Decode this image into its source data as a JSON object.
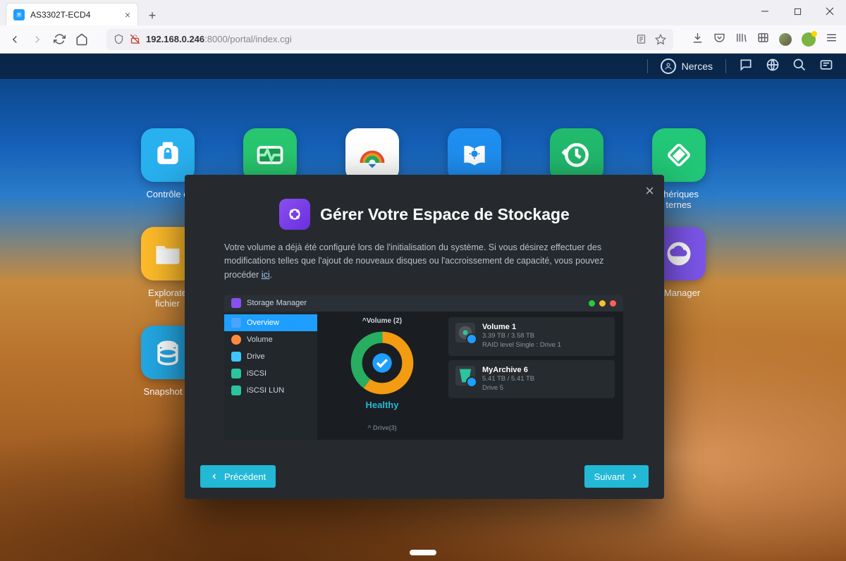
{
  "browser": {
    "tab_title": "AS3302T-ECD4",
    "url_host": "192.168.0.246",
    "url_path": ":8000/portal/index.cgi"
  },
  "adm": {
    "username": "Nerces",
    "apps_row1": [
      {
        "label": "Contrôle d",
        "bg": "#29b0ef"
      },
      {
        "label": "",
        "bg": "#28c76f"
      },
      {
        "label": "",
        "bg": "#ffffff"
      },
      {
        "label": "",
        "bg": "#1f8ef1"
      },
      {
        "label": "",
        "bg": "#21ba6d"
      },
      {
        "label": "phériques\nternes",
        "bg": "#22c777"
      }
    ],
    "apps_row2": [
      {
        "label": "Explorate\nfichier",
        "bg": "#febb2a"
      },
      {
        "label": "",
        "bg": "#FFF"
      },
      {
        "label": "",
        "bg": "#FFF"
      },
      {
        "label": "",
        "bg": "#FFF"
      },
      {
        "label": "",
        "bg": "#FFF"
      },
      {
        "label": "c Manager",
        "bg": "#7c55e9"
      }
    ],
    "apps_row3": [
      {
        "label": "Snapshot C",
        "bg": "#23a7e3"
      }
    ]
  },
  "modal": {
    "title": "Gérer Votre Espace de Stockage",
    "description_pre": "Votre volume a déjà été configuré lors de l'initialisation du système. Si vous désirez effectuer des modifications telles que l'ajout de nouveaux disques ou l'accroissement de capacité, vous pouvez procéder ",
    "description_link": "ici",
    "description_post": ".",
    "prev": "Précédent",
    "next": "Suivant",
    "storage": {
      "window_title": "Storage Manager",
      "sidebar": [
        {
          "label": "Overview",
          "color": "#4aa3ff",
          "active": true
        },
        {
          "label": "Volume",
          "color": "#ff8a3d",
          "active": false
        },
        {
          "label": "Drive",
          "color": "#3dc8ff",
          "active": false
        },
        {
          "label": "iSCSI",
          "color": "#2cc39f",
          "active": false
        },
        {
          "label": "iSCSI LUN",
          "color": "#2cc39f",
          "active": false
        }
      ],
      "volume_section": "^Volume (2)",
      "drive_section": "^ Drive(3)",
      "status": "Healthy",
      "volumes": [
        {
          "name": "Volume 1",
          "size": "3.39 TB / 3.58 TB",
          "meta": "RAID level Single : Drive 1"
        },
        {
          "name": "MyArchive 6",
          "size": "5.41 TB / 5.41 TB",
          "meta": "Drive 5"
        }
      ]
    }
  }
}
